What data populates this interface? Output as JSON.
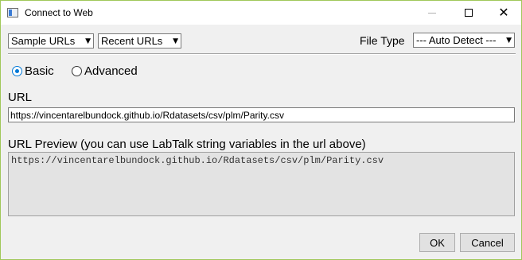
{
  "window": {
    "title": "Connect to Web",
    "controls": {
      "minimize": "minimize-icon",
      "maximize": "maximize-icon",
      "close": "✕"
    }
  },
  "toolbar": {
    "sample_urls": "Sample URLs",
    "recent_urls": "Recent URLs",
    "file_type_label": "File Type",
    "file_type_value": "--- Auto Detect ---"
  },
  "mode": {
    "basic_label": "Basic",
    "advanced_label": "Advanced",
    "selected": "Basic"
  },
  "url": {
    "label": "URL",
    "value": "https://vincentarelbundock.github.io/Rdatasets/csv/plm/Parity.csv"
  },
  "preview": {
    "label": "URL Preview (you can use LabTalk string variables in the url above)",
    "text": "https://vincentarelbundock.github.io/Rdatasets/csv/plm/Parity.csv"
  },
  "buttons": {
    "ok": "OK",
    "cancel": "Cancel"
  },
  "colors": {
    "accent": "#0078d7",
    "window_border": "#a0c85a",
    "background": "#f0f0f0"
  }
}
